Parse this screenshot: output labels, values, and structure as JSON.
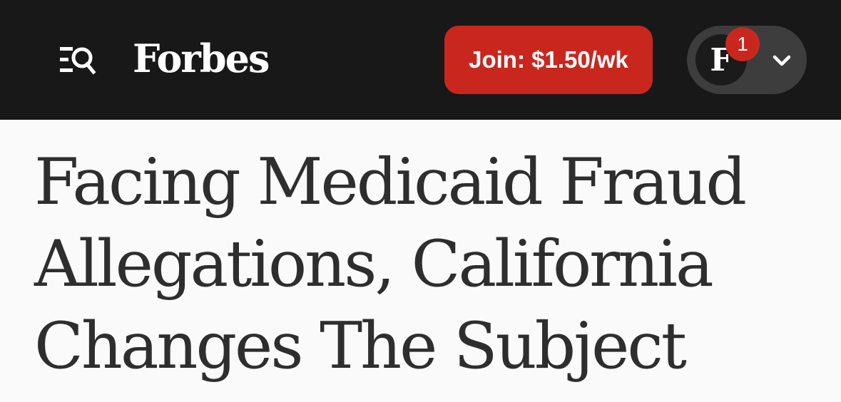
{
  "header": {
    "menu_icon": "menu-search-icon",
    "logo_text": "Forbes",
    "join_label": "Join: $1.50/wk",
    "account": {
      "avatar_letter": "F",
      "notification_count": "1",
      "dropdown_icon": "chevron-down-icon"
    }
  },
  "article": {
    "headline": "Facing Medicaid Fraud Allegations, California Changes The Subject"
  },
  "colors": {
    "header_bg": "#181818",
    "accent_red": "#c9271e",
    "pill_bg": "#3d3d3d",
    "page_bg": "#fafafa",
    "headline_text": "#2e2e2e"
  }
}
